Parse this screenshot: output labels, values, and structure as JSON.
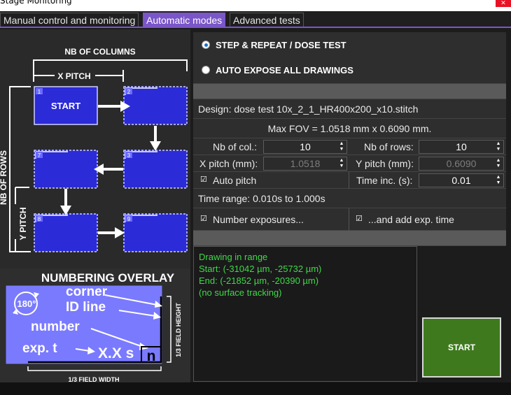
{
  "window": {
    "title": "Stage Monitoring",
    "close": "✕"
  },
  "tabs": [
    {
      "label": "Manual control and monitoring",
      "active": false
    },
    {
      "label": "Automatic modes",
      "active": true
    },
    {
      "label": "Advanced tests",
      "active": false
    }
  ],
  "diagram": {
    "nb_columns": "NB OF COLUMNS",
    "x_pitch": "X PITCH",
    "nb_rows": "NB OF ROWS",
    "y_pitch": "Y PITCH",
    "start": "START",
    "cells": [
      "1",
      "2",
      "3",
      "7",
      "8",
      "9"
    ]
  },
  "overlay": {
    "title": "NUMBERING OVERLAY",
    "rotation": "180°",
    "corner": "corner",
    "id_line": "ID line",
    "number": "number",
    "exp_t": "exp. t",
    "xxs": "X.X s",
    "n": "n",
    "field_height": "1/3 FIELD HEIGHT",
    "field_width": "1/3 FIELD WIDTH"
  },
  "modes": {
    "step_repeat": "STEP & REPEAT / DOSE TEST",
    "auto_expose": "AUTO EXPOSE ALL DRAWINGS",
    "selected": "step_repeat"
  },
  "design": "Design: dose test 10x_2_1_HR400x200_x10.stitch",
  "max_fov": "Max FOV = 1.0518 mm x 0.6090 mm.",
  "params": {
    "nb_col_label": "Nb of col.:",
    "nb_col": "10",
    "nb_rows_label": "Nb of rows:",
    "nb_rows": "10",
    "x_pitch_label": "X pitch (mm):",
    "x_pitch": "1.0518",
    "y_pitch_label": "Y pitch (mm):",
    "y_pitch": "0.6090",
    "auto_pitch": "Auto pitch",
    "time_inc_label": "Time inc. (s):",
    "time_inc": "0.01",
    "time_range": "Time range: 0.010s to 1.000s",
    "number_exposures": "Number exposures...",
    "add_exp_time": "...and add exp. time"
  },
  "console": [
    "Drawing in range",
    "Start: (-31042 µm, -25732 µm)",
    "End: (-21852 µm, -20390 µm)",
    "(no surface tracking)"
  ],
  "start_button": "START",
  "colors": {
    "accent": "#7a56c8",
    "cell": "#2b2bd8",
    "console_text": "#41d84a",
    "start": "#3e7a1d"
  }
}
